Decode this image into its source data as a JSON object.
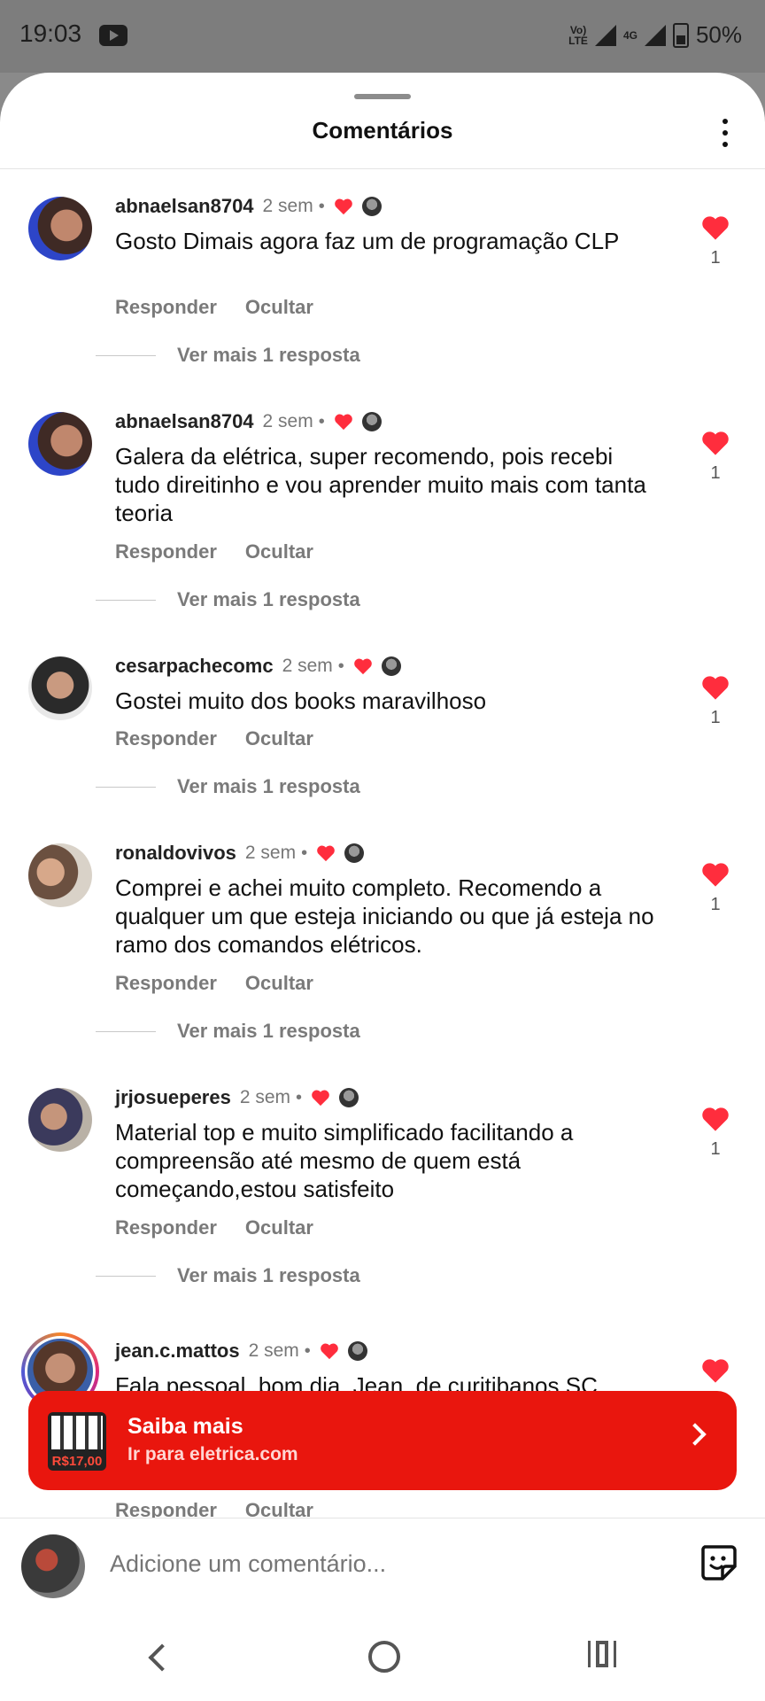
{
  "status_bar": {
    "time": "19:03",
    "network": "4G",
    "volte": "Vo)\nLTE",
    "battery": "50%"
  },
  "header": {
    "title": "Comentários"
  },
  "comments": [
    {
      "username": "abnaelsan8704",
      "time": "2 sem",
      "text": "Gosto Dimais agora faz um  de programação CLP",
      "reply": "Responder",
      "hide": "Ocultar",
      "more_replies": "Ver mais 1 resposta",
      "likes": "1"
    },
    {
      "username": "abnaelsan8704",
      "time": "2 sem",
      "text": "Galera da elétrica, super recomendo, pois recebi tudo direitinho e vou aprender muito mais com tanta teoria",
      "reply": "Responder",
      "hide": "Ocultar",
      "more_replies": "Ver mais 1 resposta",
      "likes": "1"
    },
    {
      "username": "cesarpachecomc",
      "time": "2 sem",
      "text": "Gostei muito dos books maravilhoso",
      "reply": "Responder",
      "hide": "Ocultar",
      "more_replies": "Ver mais 1 resposta",
      "likes": "1"
    },
    {
      "username": "ronaldovivos",
      "time": "2 sem",
      "text": "Comprei e achei muito completo. Recomendo a qualquer um que esteja iniciando ou que já esteja no ramo dos comandos elétricos.",
      "reply": "Responder",
      "hide": "Ocultar",
      "more_replies": "Ver mais 1 resposta",
      "likes": "1"
    },
    {
      "username": "jrjosueperes",
      "time": "2 sem",
      "text": "Material top e muito simplificado facilitando a compreensão até mesmo de quem está começando,estou satisfeito",
      "reply": "Responder",
      "hide": "Ocultar",
      "more_replies": "Ver mais 1 resposta",
      "likes": "1"
    },
    {
      "username": "jean.c.mattos",
      "time": "2 sem",
      "text": "Fala pessoal, bom dia, Jean, de curitibanos SC.",
      "reply": "Responder",
      "hide": "Ocultar"
    }
  ],
  "ad_banner": {
    "title": "Saiba mais",
    "subtitle": "Ir para eletrica.com",
    "thumb_price": "R$17,00"
  },
  "composer": {
    "placeholder": "Adicione um comentário..."
  },
  "icons": {
    "like": "heart-icon",
    "menu": "more-vertical-icon",
    "sticker": "sticker-icon",
    "chevron": "chevron-right-icon"
  },
  "colors": {
    "like_red": "#ff2d3d",
    "banner_red": "#e9160e"
  }
}
